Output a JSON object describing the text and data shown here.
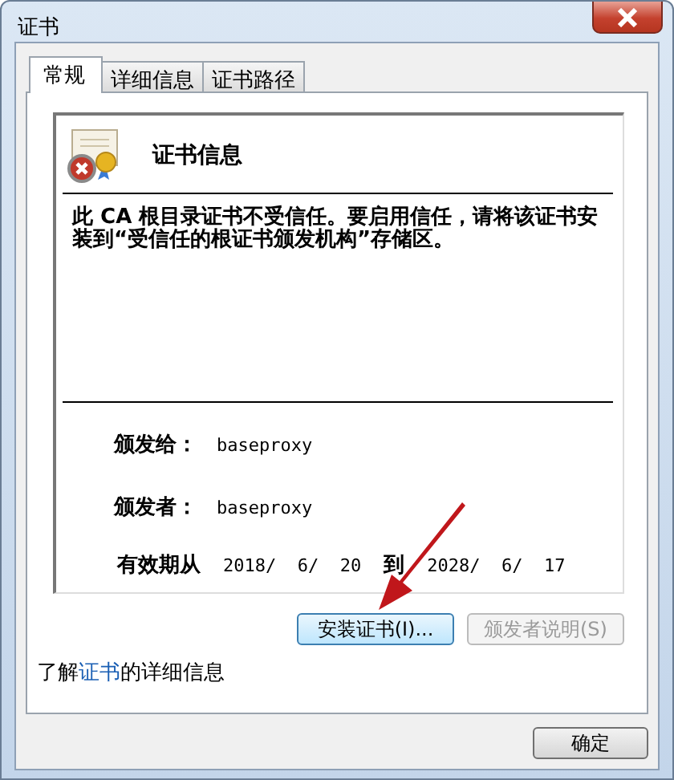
{
  "window": {
    "title": "证书"
  },
  "tabs": [
    {
      "label": "常规",
      "selected": true
    },
    {
      "label": "详细信息",
      "selected": false
    },
    {
      "label": "证书路径",
      "selected": false
    }
  ],
  "cert": {
    "heading": "证书信息",
    "trusted": false,
    "message": "此 CA 根目录证书不受信任。要启用信任，请将该证书安装到“受信任的根证书颁发机构”存储区。",
    "fields": [
      {
        "label": "颁发给：",
        "value": "baseproxy"
      },
      {
        "label": "颁发者：",
        "value": "baseproxy"
      }
    ],
    "validity": {
      "from_label": "有效期从",
      "from": "2018/  6/  20",
      "to_label": "到",
      "to": "2028/  6/  17"
    }
  },
  "buttons": [
    {
      "label": "安装证书(I)...",
      "disabled": false
    },
    {
      "label": "颁发者说明(S)",
      "disabled": true
    }
  ],
  "info_link": {
    "before": "了解",
    "link": "证书",
    "after": "的详细信息"
  },
  "ok_button": "确定"
}
